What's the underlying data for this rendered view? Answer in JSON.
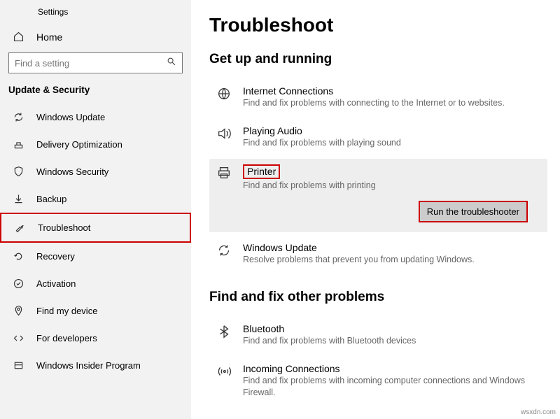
{
  "window": {
    "title": "Settings"
  },
  "sidebar": {
    "home": "Home",
    "search_placeholder": "Find a setting",
    "section": "Update & Security",
    "items": [
      {
        "label": "Windows Update"
      },
      {
        "label": "Delivery Optimization"
      },
      {
        "label": "Windows Security"
      },
      {
        "label": "Backup"
      },
      {
        "label": "Troubleshoot",
        "highlighted": true
      },
      {
        "label": "Recovery"
      },
      {
        "label": "Activation"
      },
      {
        "label": "Find my device"
      },
      {
        "label": "For developers"
      },
      {
        "label": "Windows Insider Program"
      }
    ]
  },
  "main": {
    "title": "Troubleshoot",
    "section1": "Get up and running",
    "items": [
      {
        "title": "Internet Connections",
        "desc": "Find and fix problems with connecting to the Internet or to websites."
      },
      {
        "title": "Playing Audio",
        "desc": "Find and fix problems with playing sound"
      },
      {
        "title": "Printer",
        "desc": "Find and fix problems with printing",
        "selected": true
      },
      {
        "title": "Windows Update",
        "desc": "Resolve problems that prevent you from updating Windows."
      }
    ],
    "run_button": "Run the troubleshooter",
    "section2": "Find and fix other problems",
    "items2": [
      {
        "title": "Bluetooth",
        "desc": "Find and fix problems with Bluetooth devices"
      },
      {
        "title": "Incoming Connections",
        "desc": "Find and fix problems with incoming computer connections and Windows Firewall."
      }
    ]
  },
  "watermark": "wsxdn.com"
}
